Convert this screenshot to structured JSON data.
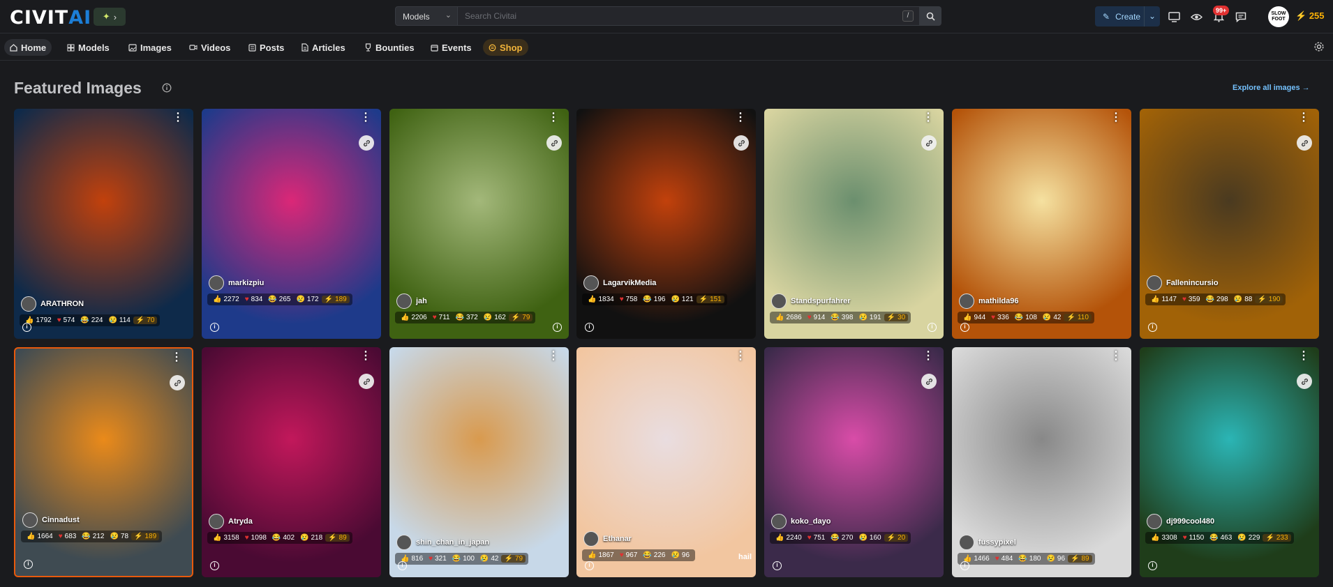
{
  "brand": {
    "logo_text_a": "CIVIT",
    "logo_text_b": "AI",
    "env_icon": "satellite-icon"
  },
  "search": {
    "category": "Models",
    "placeholder": "Search Civitai",
    "shortcut": "/"
  },
  "header": {
    "create_label": "Create",
    "notification_count": "99+",
    "avatar_text": "SLOW FOOT",
    "buzz_amount": "255"
  },
  "nav": {
    "items": [
      {
        "label": "Home",
        "icon": "home-icon"
      },
      {
        "label": "Models",
        "icon": "grid-icon"
      },
      {
        "label": "Images",
        "icon": "image-icon"
      },
      {
        "label": "Videos",
        "icon": "video-icon"
      },
      {
        "label": "Posts",
        "icon": "posts-icon"
      },
      {
        "label": "Articles",
        "icon": "article-icon"
      },
      {
        "label": "Bounties",
        "icon": "trophy-icon"
      },
      {
        "label": "Events",
        "icon": "calendar-icon"
      },
      {
        "label": "Shop",
        "icon": "shop-icon"
      }
    ]
  },
  "section": {
    "title": "Featured Images",
    "explore_label": "Explore all images"
  },
  "cards": [
    {
      "user": "ARATHRON",
      "likes": "1792",
      "hearts": "574",
      "laughs": "224",
      "cries": "114",
      "buzz": "70",
      "colors": [
        "#0e2a4a",
        "#c2410c"
      ]
    },
    {
      "user": "markizpiu",
      "likes": "2272",
      "hearts": "834",
      "laughs": "265",
      "cries": "172",
      "buzz": "189",
      "colors": [
        "#1e3a8a",
        "#db2777"
      ]
    },
    {
      "user": "jah",
      "likes": "2206",
      "hearts": "711",
      "laughs": "372",
      "cries": "162",
      "buzz": "79",
      "colors": [
        "#3f6212",
        "#a3b87a"
      ]
    },
    {
      "user": "LagarvikMedia",
      "likes": "1834",
      "hearts": "758",
      "laughs": "196",
      "cries": "121",
      "buzz": "151",
      "colors": [
        "#111111",
        "#c2410c"
      ]
    },
    {
      "user": "Standspurfahrer",
      "likes": "2686",
      "hearts": "914",
      "laughs": "398",
      "cries": "191",
      "buzz": "30",
      "colors": [
        "#d8d4a0",
        "#6b8f6e"
      ]
    },
    {
      "user": "mathilda96",
      "likes": "944",
      "hearts": "336",
      "laughs": "108",
      "cries": "42",
      "buzz": "110",
      "colors": [
        "#b45309",
        "#f5e1a0"
      ]
    },
    {
      "user": "Fallenincursio",
      "likes": "1147",
      "hearts": "359",
      "laughs": "298",
      "cries": "88",
      "buzz": "190",
      "colors": [
        "#a16207",
        "#4a3a20"
      ]
    },
    {
      "user": "Cinnadust",
      "likes": "1664",
      "hearts": "683",
      "laughs": "212",
      "cries": "78",
      "buzz": "189",
      "colors": [
        "#3f4b52",
        "#ea8a1a"
      ]
    },
    {
      "user": "Atryda",
      "likes": "3158",
      "hearts": "1098",
      "laughs": "402",
      "cries": "218",
      "buzz": "89",
      "colors": [
        "#4a0a33",
        "#c2185b"
      ]
    },
    {
      "user": "shin_chan_in_japan",
      "likes": "816",
      "hearts": "321",
      "laughs": "100",
      "cries": "42",
      "buzz": "79",
      "colors": [
        "#c7d8e8",
        "#d99a4e"
      ]
    },
    {
      "user": "Ethanar",
      "likes": "1867",
      "hearts": "967",
      "laughs": "226",
      "cries": "96",
      "buzz": "",
      "colors": [
        "#f2c6a0",
        "#e9dde0"
      ]
    },
    {
      "user": "koko_dayo",
      "likes": "2240",
      "hearts": "751",
      "laughs": "270",
      "cries": "160",
      "buzz": "20",
      "colors": [
        "#3b2a4a",
        "#d94ca8"
      ]
    },
    {
      "user": "fussypixel",
      "likes": "1466",
      "hearts": "484",
      "laughs": "180",
      "cries": "96",
      "buzz": "89",
      "colors": [
        "#d9d9d9",
        "#888888"
      ]
    },
    {
      "user": "dj999cool480",
      "likes": "3308",
      "hearts": "1150",
      "laughs": "463",
      "cries": "229",
      "buzz": "233",
      "colors": [
        "#1f3d1a",
        "#2bb5b5"
      ]
    }
  ],
  "card_extra": {
    "ethanar_overlay": "hail"
  }
}
